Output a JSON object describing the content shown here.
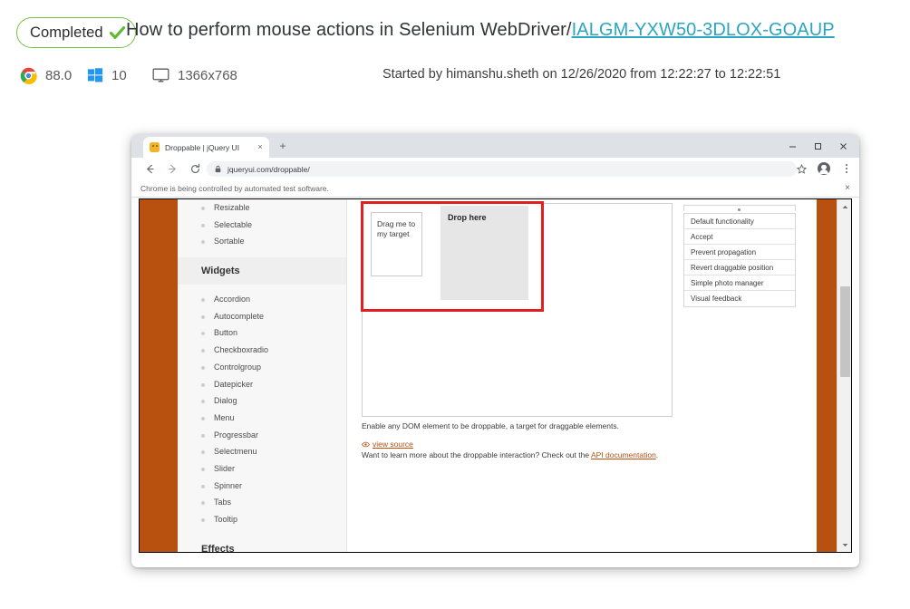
{
  "header": {
    "status": {
      "label": "Completed",
      "icon": "check-icon",
      "color": "#76c043"
    },
    "title_prefix": "How to perform mouse actions in Selenium WebDriver/",
    "title_link": "IALGM-YXW50-3DLOX-GOAUP",
    "link_color": "#2aa6c0",
    "meta": {
      "browser_icon": "chrome-icon",
      "browser_version": "88.0",
      "os_icon": "windows-icon",
      "os_version": "10",
      "resolution_icon": "monitor-icon",
      "resolution": "1366x768"
    },
    "started_by": "Started by himanshu.sheth on 12/26/2020 from 12:22:27 to 12:22:51"
  },
  "browser": {
    "tab": {
      "title": "Droppable | jQuery UI",
      "favicon": "jquery-ui-favicon",
      "close": "×"
    },
    "new_tab": "+",
    "window_controls": {
      "minimize": "minimize-icon",
      "maximize": "maximize-icon",
      "close": "close-icon"
    },
    "toolbar": {
      "back": "back-arrow-icon",
      "forward": "forward-arrow-icon",
      "reload": "reload-icon",
      "lock": "lock-icon",
      "url": "jqueryui.com/droppable/",
      "bookmark": "star-icon",
      "profile": "profile-avatar-icon",
      "menu": "kebab-menu-icon"
    },
    "infobar": {
      "message": "Chrome is being controlled by automated test software.",
      "close": "×"
    }
  },
  "page": {
    "stripe_color": "#b8500f",
    "nav": {
      "top_items": [
        "Resizable",
        "Selectable",
        "Sortable"
      ],
      "widgets_heading": "Widgets",
      "widget_items": [
        "Accordion",
        "Autocomplete",
        "Button",
        "Checkboxradio",
        "Controlgroup",
        "Datepicker",
        "Dialog",
        "Menu",
        "Progressbar",
        "Selectmenu",
        "Slider",
        "Spinner",
        "Tabs",
        "Tooltip"
      ],
      "effects_heading": "Effects"
    },
    "demo": {
      "draggable_label": "Drag me to my target",
      "droppable_label": "Drop here",
      "highlight_color": "#e02020",
      "description": "Enable any DOM element to be droppable, a target for draggable elements.",
      "view_source": "view source",
      "more_text_before": "Want to learn more about the droppable interaction? Check out the ",
      "more_link": "API documentation",
      "more_text_after": "."
    },
    "demo_list": [
      "Default functionality",
      "Accept",
      "Prevent propagation",
      "Revert draggable position",
      "Simple photo manager",
      "Visual feedback"
    ]
  }
}
